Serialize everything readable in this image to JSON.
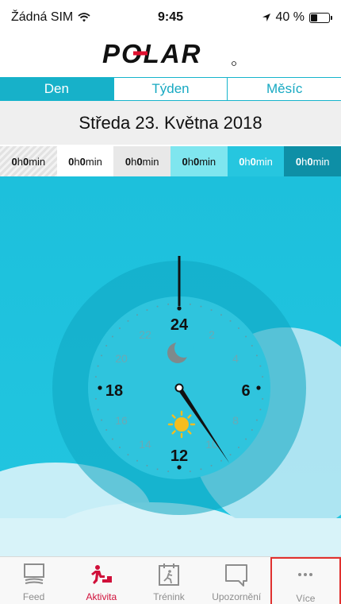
{
  "status_bar": {
    "carrier": "Žádná SIM",
    "time": "9:45",
    "battery_text": "40 %",
    "battery_level": 0.4
  },
  "header": {
    "logo_text": "POLAR"
  },
  "tabs": [
    {
      "label": "Den",
      "active": true
    },
    {
      "label": "Týden",
      "active": false
    },
    {
      "label": "Měsíc",
      "active": false
    }
  ],
  "date": "Středa 23. Května 2018",
  "durations": [
    {
      "h": "0",
      "m": "0",
      "h_unit": "h",
      "m_unit": "min"
    },
    {
      "h": "0",
      "m": "0",
      "h_unit": "h",
      "m_unit": "min"
    },
    {
      "h": "0",
      "m": "0",
      "h_unit": "h",
      "m_unit": "min"
    },
    {
      "h": "0",
      "m": "0",
      "h_unit": "h",
      "m_unit": "min"
    },
    {
      "h": "0",
      "m": "0",
      "h_unit": "h",
      "m_unit": "min"
    },
    {
      "h": "0",
      "m": "0",
      "h_unit": "h",
      "m_unit": "min"
    }
  ],
  "clock": {
    "labels_major": {
      "top": "24",
      "right": "6",
      "bottom": "12",
      "left": "18"
    },
    "labels_minor": [
      "2",
      "4",
      "8",
      "10",
      "14",
      "16",
      "20",
      "22"
    ],
    "current_hour": 9.75
  },
  "nav": [
    {
      "label": "Feed",
      "icon": "feed-icon",
      "active": false
    },
    {
      "label": "Aktivita",
      "icon": "activity-icon",
      "active": true
    },
    {
      "label": "Trénink",
      "icon": "training-icon",
      "active": false
    },
    {
      "label": "Upozornění",
      "icon": "notification-icon",
      "active": false
    },
    {
      "label": "Více",
      "icon": "more-icon",
      "active": false
    }
  ],
  "colors": {
    "accent": "#17b1c9",
    "nav_active": "#d0103a",
    "highlight": "#e0312f"
  }
}
